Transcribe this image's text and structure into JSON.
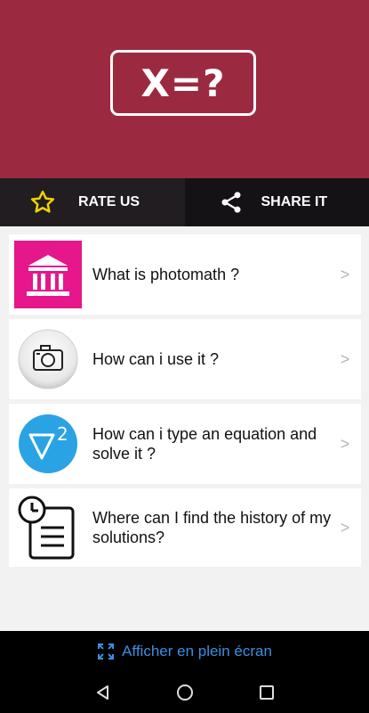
{
  "header": {
    "logo_text": "X=?",
    "bg_color": "#9b2a40"
  },
  "actions": {
    "rate_label": "RATE US",
    "share_label": "SHARE IT"
  },
  "topics": [
    {
      "title": "What is photomath ?",
      "icon": "bank-icon",
      "chevron": ">"
    },
    {
      "title": "How can i use it ?",
      "icon": "camera-icon",
      "chevron": ">"
    },
    {
      "title": "How can i type an equation and solve it ?",
      "icon": "nabla-squared-icon",
      "chevron": ">"
    },
    {
      "title": "Where can I find the history of my solutions?",
      "icon": "history-document-icon",
      "chevron": ">"
    }
  ],
  "fullscreen": {
    "label": "Afficher en plein écran",
    "color": "#3b8fe0"
  },
  "accent": {
    "pink": "#e6168b",
    "blue": "#29a3e3",
    "star": "#f0d400"
  }
}
